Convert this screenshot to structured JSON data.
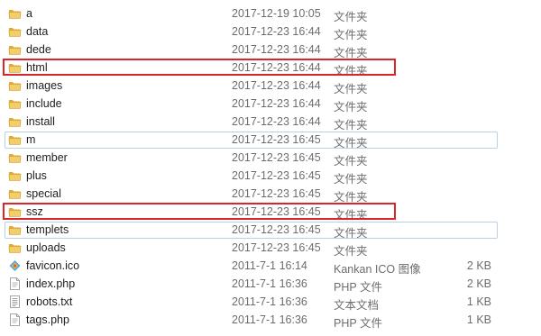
{
  "files": [
    {
      "name": "a",
      "date": "2017-12-19 10:05",
      "type": "文件夹",
      "size": "",
      "icon": "folder-icon"
    },
    {
      "name": "data",
      "date": "2017-12-23 16:44",
      "type": "文件夹",
      "size": "",
      "icon": "folder-icon"
    },
    {
      "name": "dede",
      "date": "2017-12-23 16:44",
      "type": "文件夹",
      "size": "",
      "icon": "folder-icon"
    },
    {
      "name": "html",
      "date": "2017-12-23 16:44",
      "type": "文件夹",
      "size": "",
      "icon": "folder-icon",
      "highlighted": true
    },
    {
      "name": "images",
      "date": "2017-12-23 16:44",
      "type": "文件夹",
      "size": "",
      "icon": "folder-icon"
    },
    {
      "name": "include",
      "date": "2017-12-23 16:44",
      "type": "文件夹",
      "size": "",
      "icon": "folder-icon"
    },
    {
      "name": "install",
      "date": "2017-12-23 16:44",
      "type": "文件夹",
      "size": "",
      "icon": "folder-icon"
    },
    {
      "name": "m",
      "date": "2017-12-23 16:45",
      "type": "文件夹",
      "size": "",
      "icon": "folder-icon",
      "selected": true
    },
    {
      "name": "member",
      "date": "2017-12-23 16:45",
      "type": "文件夹",
      "size": "",
      "icon": "folder-icon"
    },
    {
      "name": "plus",
      "date": "2017-12-23 16:45",
      "type": "文件夹",
      "size": "",
      "icon": "folder-icon"
    },
    {
      "name": "special",
      "date": "2017-12-23 16:45",
      "type": "文件夹",
      "size": "",
      "icon": "folder-icon"
    },
    {
      "name": "ssz",
      "date": "2017-12-23 16:45",
      "type": "文件夹",
      "size": "",
      "icon": "folder-icon",
      "highlighted": true
    },
    {
      "name": "templets",
      "date": "2017-12-23 16:45",
      "type": "文件夹",
      "size": "",
      "icon": "folder-icon",
      "selected": true
    },
    {
      "name": "uploads",
      "date": "2017-12-23 16:45",
      "type": "文件夹",
      "size": "",
      "icon": "folder-icon"
    },
    {
      "name": "favicon.ico",
      "date": "2011-7-1 16:14",
      "type": "Kankan ICO 图像",
      "size": "2 KB",
      "icon": "ico-file-icon"
    },
    {
      "name": "index.php",
      "date": "2011-7-1 16:36",
      "type": "PHP 文件",
      "size": "2 KB",
      "icon": "php-file-icon"
    },
    {
      "name": "robots.txt",
      "date": "2011-7-1 16:36",
      "type": "文本文档",
      "size": "1 KB",
      "icon": "text-file-icon"
    },
    {
      "name": "tags.php",
      "date": "2011-7-1 16:36",
      "type": "PHP 文件",
      "size": "1 KB",
      "icon": "php-file-icon"
    }
  ],
  "colors": {
    "highlight_border": "#d9262b",
    "selection_border": "#b8d0ea",
    "folder_body": "#f2cf6b",
    "folder_tab": "#e0aa33",
    "secondary_text": "#6d6d6d"
  }
}
